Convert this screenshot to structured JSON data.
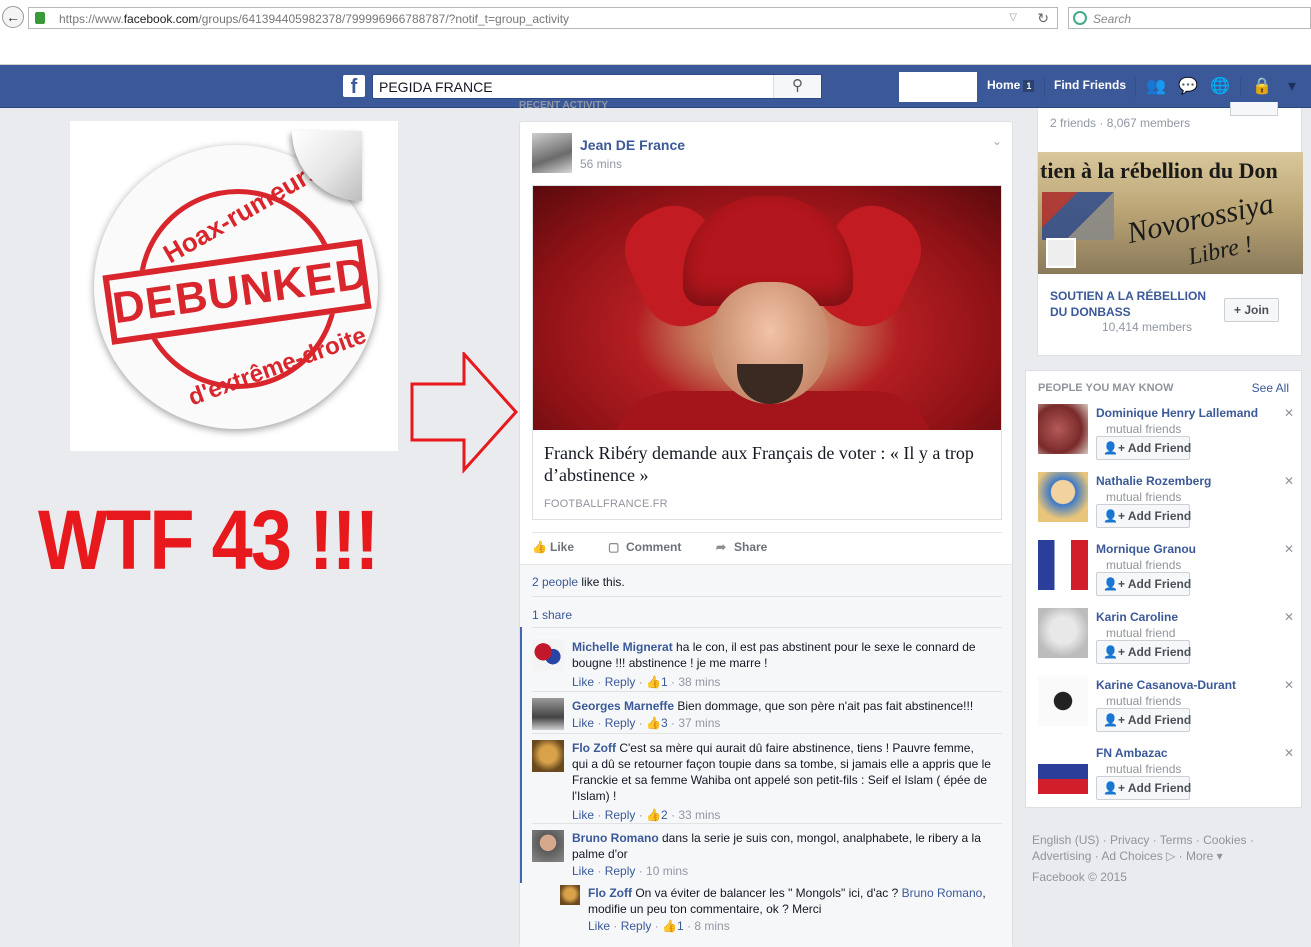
{
  "browser": {
    "url_prefix": "https://www.",
    "url_domain": "facebook.com",
    "url_path": "/groups/641394405982378/799996966788787/?notif_t=group_activity",
    "search_placeholder": "Search"
  },
  "fb": {
    "search_value": "PEGIDA FRANCE",
    "nav_home": "Home",
    "nav_home_badge": "1",
    "nav_find_friends": "Find Friends"
  },
  "overlay": {
    "sticker_top": "Hoax-rumeurs",
    "sticker_stamp": "DEBUNKED",
    "sticker_bottom": "d'extrême-droite",
    "wtf_text": "WTF 43 !!!"
  },
  "post": {
    "recent_label": "RECENT ACTIVITY",
    "author": "Jean DE France",
    "time": "56 mins",
    "headline": "Franck Ribéry demande aux Français de voter : « Il y a trop d’abstinence »",
    "source": "FOOTBALLFRANCE.FR",
    "actions": [
      "Like",
      "Comment",
      "Share"
    ],
    "likes_link": "2 people",
    "likes_rest": " like this.",
    "shares": "1 share",
    "comments": [
      {
        "name": "Michelle Mignerat",
        "text": " ha le con, il est pas abstinent pour le sexe le connard de bougne !!! abstinence ! je me marre !",
        "like": "Like",
        "reply": "Reply",
        "likes": "1",
        "time": "38 mins"
      },
      {
        "name": "Georges Marneffe",
        "text": " Bien dommage, que son père n'ait pas fait abstinence!!!",
        "like": "Like",
        "reply": "Reply",
        "likes": "3",
        "time": "37 mins"
      },
      {
        "name": "Flo Zoff",
        "text": " C'est sa mère qui aurait dû faire abstinence, tiens ! Pauvre femme, qui a dû se retourner façon toupie dans sa tombe, si jamais elle a appris que le Franckie et sa femme Wahiba ont appelé son petit-fils : Seif el Islam ( épée de l'Islam) !",
        "like": "Like",
        "reply": "Reply",
        "likes": "2",
        "time": "33 mins"
      },
      {
        "name": "Bruno Romano",
        "text": " dans la serie je suis con, mongol, analphabete, le ribery a la palme d'or",
        "like": "Like",
        "reply": "Reply",
        "likes": "",
        "time": "10 mins"
      }
    ],
    "reply": {
      "name": "Flo Zoff",
      "text_a": " On va éviter de balancer les \" Mongols\" ici, d'ac ? ",
      "mention": "Bruno Romano",
      "text_b": ", modifie un peu ton commentaire, ok ? Merci",
      "like": "Like",
      "reply": "Reply",
      "likes": "1",
      "time": "8 mins"
    }
  },
  "right": {
    "group1_meta": "2 friends · 8,067 members",
    "banner_title": "tien à la rébellion du Don",
    "banner_sub1": "Novorossiya",
    "banner_sub2": "Libre !",
    "group2_name": "SOUTIEN A LA RÉBELLION DU DONBASS",
    "group2_members": "10,414 members",
    "join_label": "+ Join",
    "pymk_header": "PEOPLE YOU MAY KNOW",
    "see_all": "See All",
    "people": [
      {
        "name": "Dominique Henry Lallemand",
        "mutual": "mutual friends",
        "add": "Add Friend"
      },
      {
        "name": "Nathalie Rozemberg",
        "mutual": "mutual friends",
        "add": "Add Friend"
      },
      {
        "name": "Mornique Granou",
        "mutual": "mutual friends",
        "add": "Add Friend"
      },
      {
        "name": "Karin Caroline",
        "mutual": "mutual friend",
        "add": "Add Friend"
      },
      {
        "name": "Karine Casanova-Durant",
        "mutual": "mutual friends",
        "add": "Add Friend"
      },
      {
        "name": "FN Ambazac",
        "mutual": "mutual friends",
        "add": "Add Friend"
      }
    ],
    "footer_line1": "English (US) · Privacy · Terms · Cookies ·",
    "footer_line2": "Advertising · Ad Choices ▷ · More ▾",
    "copyright": "Facebook © 2015"
  },
  "colors": {
    "fb_blue": "#3b5998",
    "accent_red": "#e8191c",
    "link_blue": "#3b5998"
  }
}
